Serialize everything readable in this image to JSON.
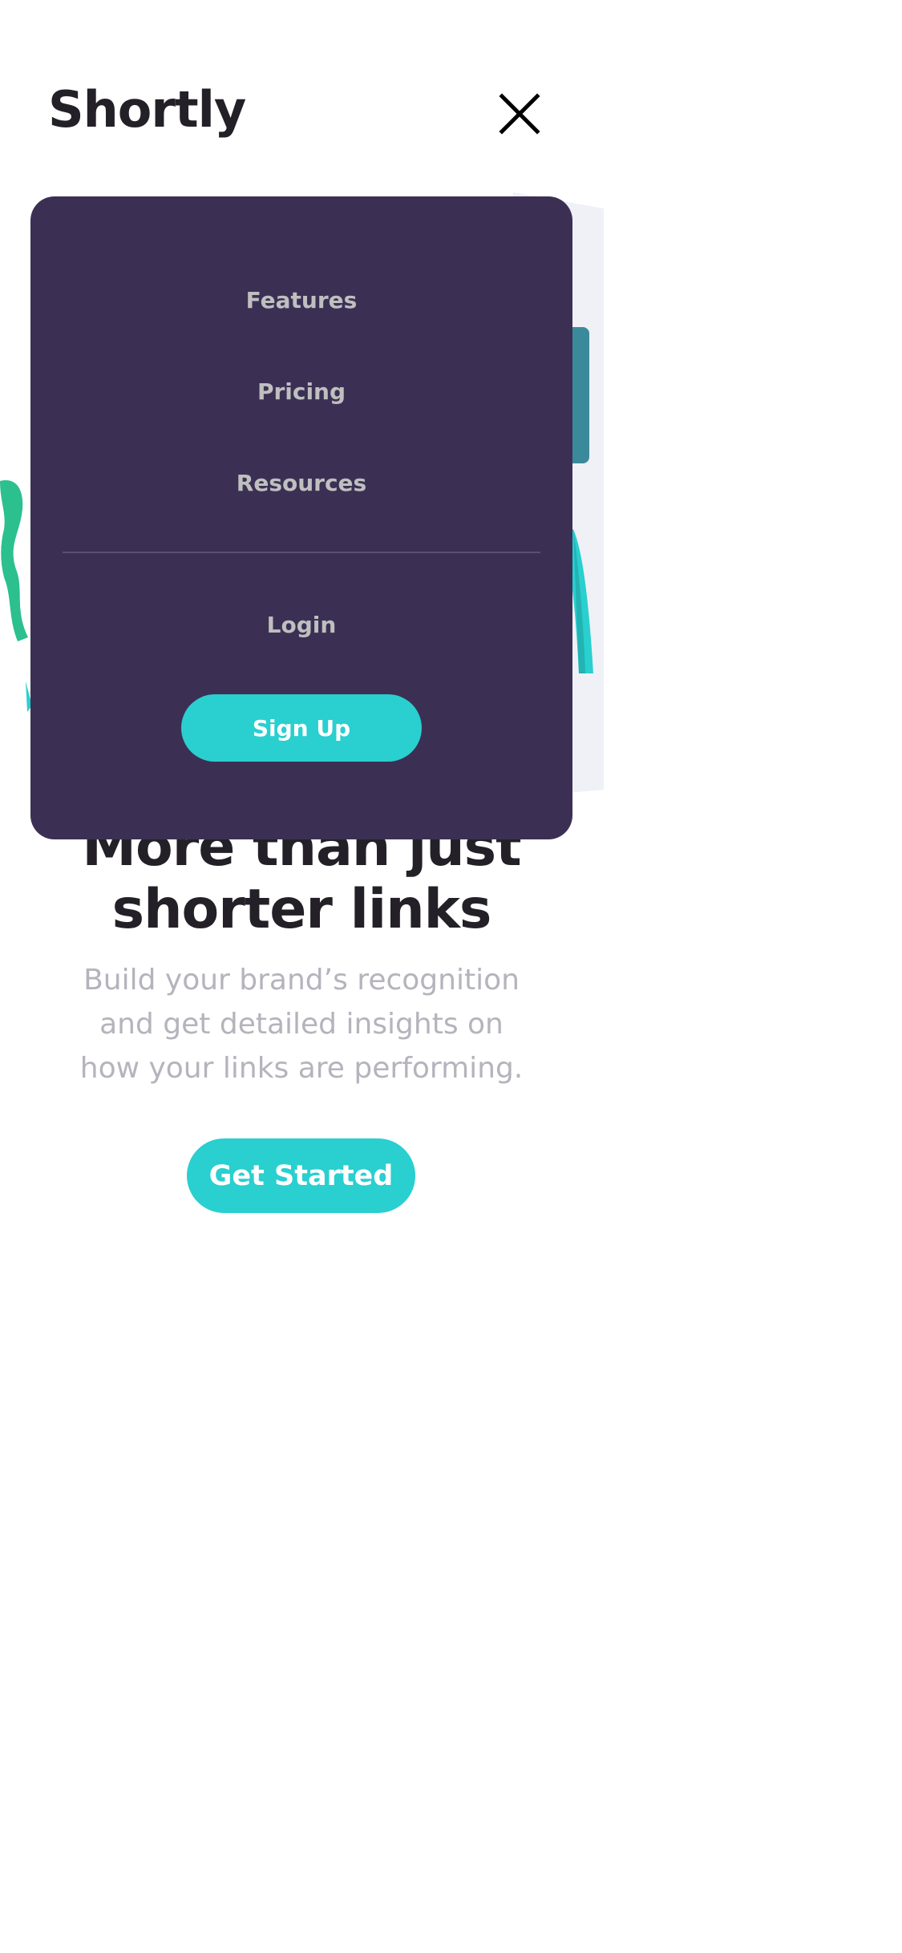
{
  "header": {
    "logo": "Shortly",
    "close_icon": "close-icon"
  },
  "menu": {
    "items": [
      {
        "label": "Features"
      },
      {
        "label": "Pricing"
      },
      {
        "label": "Resources"
      }
    ],
    "login_label": "Login",
    "signup_label": "Sign Up"
  },
  "hero": {
    "title_line1": "More than just",
    "title_line2": "shorter links",
    "subtitle": "Build your brand’s recognition and get detailed insights on how your links are performing.",
    "cta_label": "Get Started"
  },
  "colors": {
    "menu_bg": "#3b3054",
    "accent": "#2acfcf",
    "dark_text": "#232127",
    "muted_text": "#b5b3bc"
  }
}
